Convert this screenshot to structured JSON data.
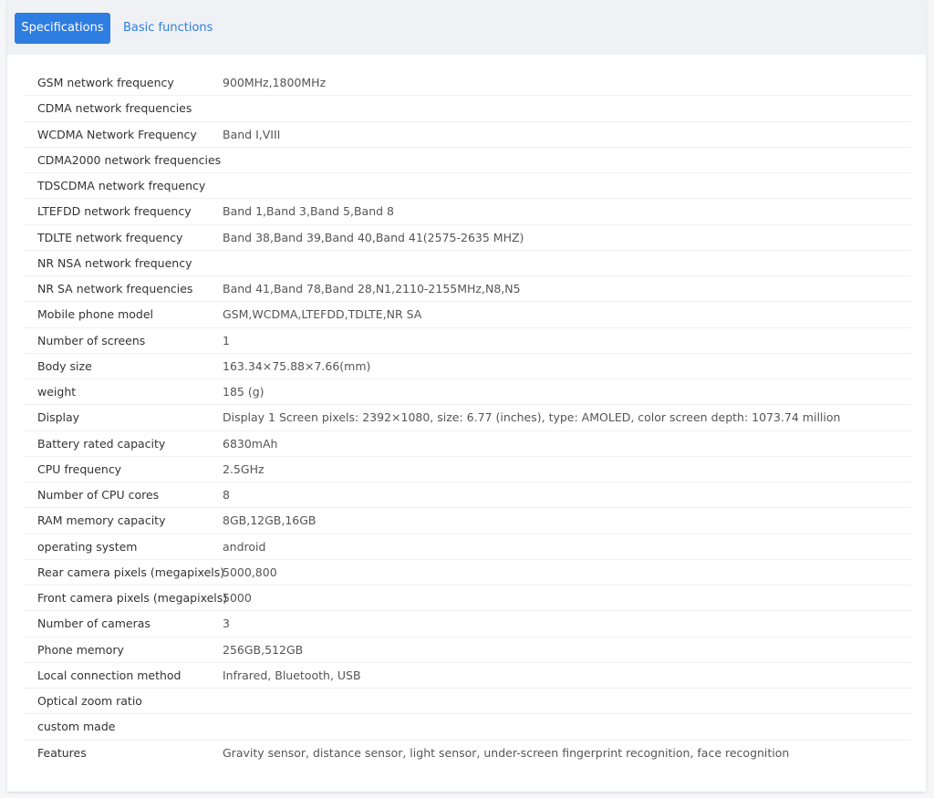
{
  "tabs": {
    "active_label": "Specifications",
    "inactive_label": "Basic functions"
  },
  "colors": {
    "accent": "#2e7de0",
    "tabbar_bg": "#eff1f5",
    "row_divider": "#edf0f3"
  },
  "specs": [
    {
      "label": "GSM network frequency",
      "value": "900MHz,1800MHz"
    },
    {
      "label": "CDMA network frequencies",
      "value": ""
    },
    {
      "label": "WCDMA Network Frequency",
      "value": "Band I,VIII"
    },
    {
      "label": "CDMA2000 network frequencies",
      "value": ""
    },
    {
      "label": "TDSCDMA network frequency",
      "value": ""
    },
    {
      "label": "LTEFDD network frequency",
      "value": "Band 1,Band 3,Band 5,Band 8"
    },
    {
      "label": "TDLTE network frequency",
      "value": "Band 38,Band 39,Band 40,Band 41(2575-2635 MHZ)"
    },
    {
      "label": "NR NSA network frequency",
      "value": ""
    },
    {
      "label": "NR SA network frequencies",
      "value": "Band 41,Band 78,Band 28,N1,2110-2155MHz,N8,N5"
    },
    {
      "label": "Mobile phone model",
      "value": "GSM,WCDMA,LTEFDD,TDLTE,NR SA"
    },
    {
      "label": "Number of screens",
      "value": "1"
    },
    {
      "label": "Body size",
      "value": "163.34×75.88×7.66(mm)"
    },
    {
      "label": "weight",
      "value": "185 (g)"
    },
    {
      "label": "Display",
      "value": "Display 1 Screen pixels: 2392×1080, size: 6.77 (inches), type: AMOLED, color screen depth: 1073.74 million"
    },
    {
      "label": "Battery rated capacity",
      "value": "6830mAh"
    },
    {
      "label": "CPU frequency",
      "value": "2.5GHz"
    },
    {
      "label": "Number of CPU cores",
      "value": "8"
    },
    {
      "label": "RAM memory capacity",
      "value": "8GB,12GB,16GB"
    },
    {
      "label": "operating system",
      "value": "android"
    },
    {
      "label": "Rear camera pixels (megapixels)",
      "value": "5000,800"
    },
    {
      "label": "Front camera pixels (megapixels)",
      "value": "5000"
    },
    {
      "label": "Number of cameras",
      "value": "3"
    },
    {
      "label": "Phone memory",
      "value": "256GB,512GB"
    },
    {
      "label": "Local connection method",
      "value": "Infrared, Bluetooth, USB"
    },
    {
      "label": "Optical zoom ratio",
      "value": ""
    },
    {
      "label": "custom made",
      "value": ""
    },
    {
      "label": "Features",
      "value": "Gravity sensor, distance sensor, light sensor, under-screen fingerprint recognition, face recognition"
    }
  ]
}
